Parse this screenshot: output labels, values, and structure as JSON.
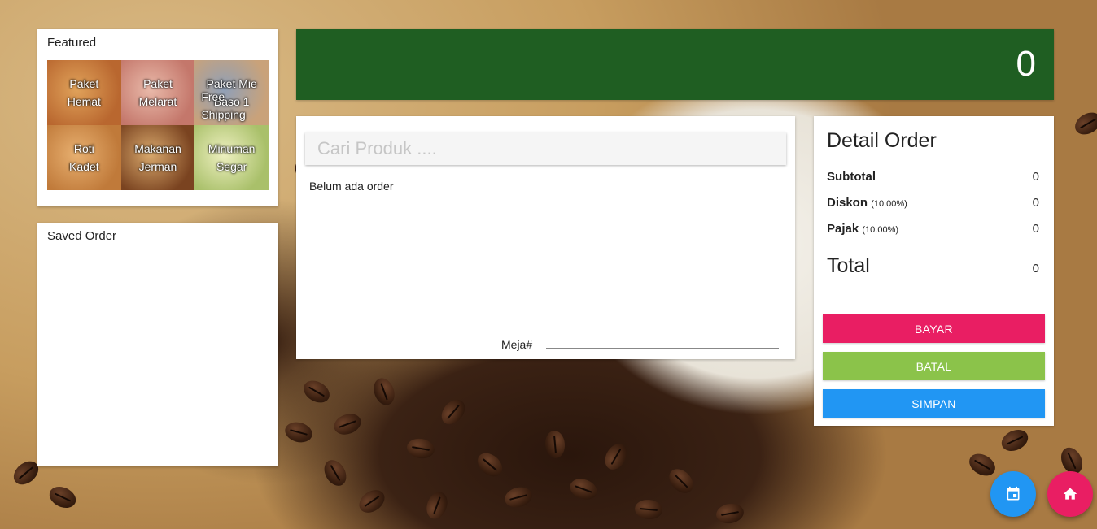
{
  "featured": {
    "title": "Featured",
    "items": [
      {
        "line1": "Paket",
        "line2": "Hemat",
        "colors": [
          "#b9672f",
          "#e0a25a"
        ]
      },
      {
        "line1": "Paket",
        "line2": "Melarat",
        "colors": [
          "#c4776b",
          "#e9b9a9"
        ]
      },
      {
        "line1": "Paket Mie",
        "line2": "Baso 1",
        "colors": [
          "#c9a27a",
          "#8fa0b8"
        ],
        "badge": [
          "Free",
          "Shipping"
        ]
      },
      {
        "line1": "Roti",
        "line2": "Kadet",
        "colors": [
          "#c07a3a",
          "#e8b070"
        ]
      },
      {
        "line1": "Makanan",
        "line2": "Jerman",
        "colors": [
          "#7a4320",
          "#d8a86c"
        ]
      },
      {
        "line1": "Minuman",
        "line2": "Segar",
        "colors": [
          "#a9c06a",
          "#eef0c0"
        ]
      }
    ]
  },
  "saved": {
    "title": "Saved Order"
  },
  "total_bar": {
    "amount": "0",
    "color": "#1f5e22"
  },
  "order": {
    "search_placeholder": "Cari Produk ....",
    "empty_text": "Belum ada order",
    "meja_label": "Meja#"
  },
  "detail": {
    "title": "Detail Order",
    "subtotal_label": "Subtotal",
    "subtotal_value": "0",
    "diskon_label": "Diskon",
    "diskon_rate": "(10.00%)",
    "diskon_value": "0",
    "pajak_label": "Pajak",
    "pajak_rate": "(10.00%)",
    "pajak_value": "0",
    "total_label": "Total",
    "total_value": "0"
  },
  "actions": {
    "bayar": "BAYAR",
    "batal": "BATAL",
    "simpan": "SIMPAN"
  },
  "fabs": {
    "calendar_icon": "calendar-icon",
    "home_icon": "home-icon"
  }
}
